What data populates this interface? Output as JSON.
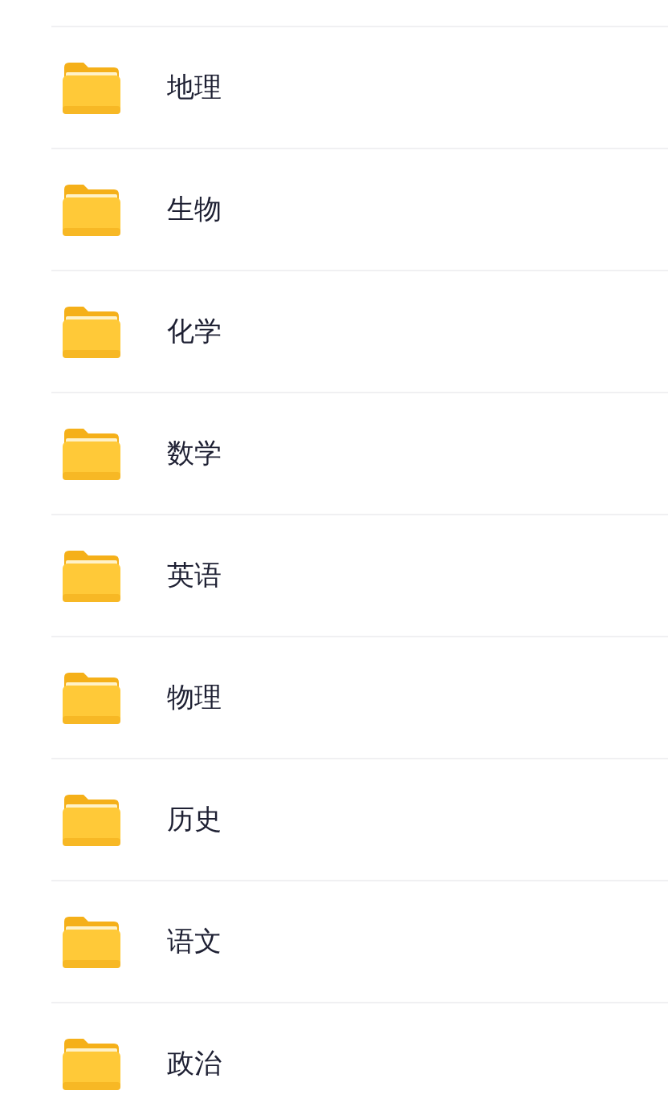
{
  "folders": [
    {
      "name": "地理"
    },
    {
      "name": "生物"
    },
    {
      "name": "化学"
    },
    {
      "name": "数学"
    },
    {
      "name": "英语"
    },
    {
      "name": "物理"
    },
    {
      "name": "历史"
    },
    {
      "name": "语文"
    },
    {
      "name": "政治"
    }
  ]
}
